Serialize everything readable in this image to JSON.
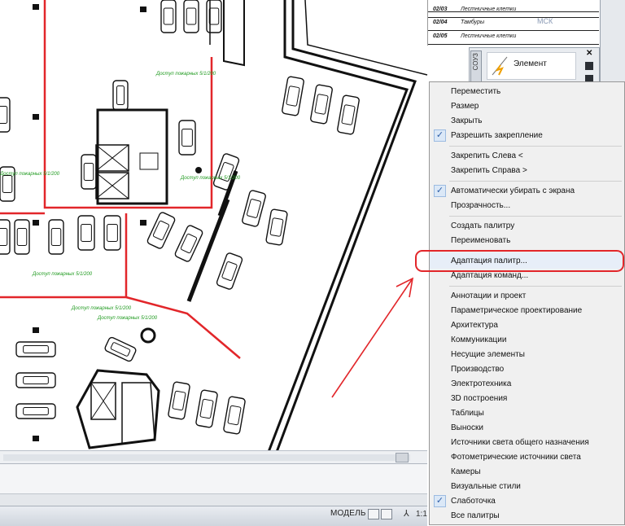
{
  "title_block": {
    "rows": [
      {
        "code": "",
        "text": ""
      },
      {
        "code": "02/03",
        "text": "Лестничные клетки"
      },
      {
        "code": "02/04",
        "text": "Тамбуры"
      },
      {
        "code": "02/05",
        "text": "Лестничные клетки"
      }
    ],
    "ucs": "МСК"
  },
  "tool_palette": {
    "tab_label": "СОУЗ",
    "item_label": "Элемент",
    "close_glyph": "✕"
  },
  "drawing": {
    "labels": [
      "Доступ пожарных 5/1/200",
      "Доступ пожарных 5/1/200",
      "Доступ пожарных 5/1/200",
      "Доступ пожарных 5/1/200",
      "Доступ пожарных 5/1/200",
      "Доступ пожарных 5/1/200"
    ]
  },
  "context_menu": {
    "items": [
      {
        "label": "Переместить",
        "checked": false,
        "sep_after": false
      },
      {
        "label": "Размер",
        "checked": false,
        "sep_after": false
      },
      {
        "label": "Закрыть",
        "checked": false,
        "sep_after": false
      },
      {
        "label": "Разрешить закрепление",
        "checked": true,
        "sep_after": true
      },
      {
        "label": "Закрепить Слева <",
        "checked": false,
        "sep_after": false
      },
      {
        "label": "Закрепить Справа  >",
        "checked": false,
        "sep_after": true
      },
      {
        "label": "Автоматически убирать с экрана",
        "checked": true,
        "sep_after": false
      },
      {
        "label": "Прозрачность...",
        "checked": false,
        "sep_after": true
      },
      {
        "label": "Создать палитру",
        "checked": false,
        "sep_after": false
      },
      {
        "label": "Переименовать",
        "checked": false,
        "sep_after": true
      },
      {
        "label": "Адаптация палитр...",
        "checked": false,
        "sep_after": false,
        "highlighted": true
      },
      {
        "label": "Адаптация команд...",
        "checked": false,
        "sep_after": true
      },
      {
        "label": "Аннотации и проект",
        "checked": false,
        "sep_after": false
      },
      {
        "label": "Параметрическое проектирование",
        "checked": false,
        "sep_after": false
      },
      {
        "label": "Архитектура",
        "checked": false,
        "sep_after": false
      },
      {
        "label": "Коммуникации",
        "checked": false,
        "sep_after": false
      },
      {
        "label": "Несущие элементы",
        "checked": false,
        "sep_after": false
      },
      {
        "label": "Производство",
        "checked": false,
        "sep_after": false
      },
      {
        "label": "Электротехника",
        "checked": false,
        "sep_after": false
      },
      {
        "label": "3D построения",
        "checked": false,
        "sep_after": false
      },
      {
        "label": "Таблицы",
        "checked": false,
        "sep_after": false
      },
      {
        "label": "Выноски",
        "checked": false,
        "sep_after": false
      },
      {
        "label": "Источники света общего назначения",
        "checked": false,
        "sep_after": false
      },
      {
        "label": "Фотометрические источники света",
        "checked": false,
        "sep_after": false
      },
      {
        "label": "Камеры",
        "checked": false,
        "sep_after": false
      },
      {
        "label": "Визуальные стили",
        "checked": false,
        "sep_after": false
      },
      {
        "label": "Слаботочка",
        "checked": true,
        "sep_after": false
      },
      {
        "label": "Все палитры",
        "checked": false,
        "sep_after": false
      }
    ]
  },
  "status_bar": {
    "model_label": "МОДЕЛЬ",
    "scale": "1:1"
  },
  "colors": {
    "annotation_red": "#e2262a",
    "label_green": "#1f9a1f",
    "check_blue": "#2e5fa7"
  }
}
